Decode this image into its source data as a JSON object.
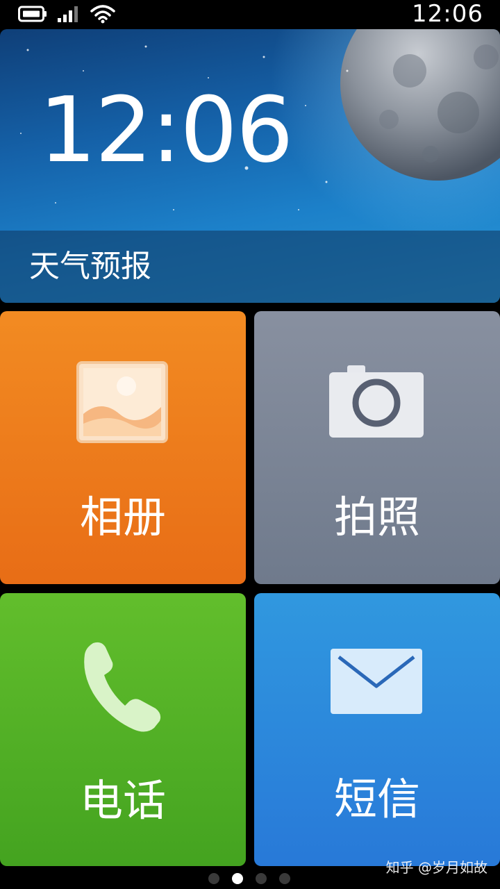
{
  "status_bar": {
    "time": "12:06",
    "icons": [
      "battery-icon",
      "signal-icon",
      "wifi-icon"
    ]
  },
  "banner": {
    "clock": "12:06",
    "weather_label": "天气预报"
  },
  "tiles": [
    {
      "label": "相册",
      "icon": "gallery-icon",
      "color": "#f0801c"
    },
    {
      "label": "拍照",
      "icon": "camera-icon",
      "color": "#7c8597"
    },
    {
      "label": "电话",
      "icon": "phone-icon",
      "color": "#52b126"
    },
    {
      "label": "短信",
      "icon": "mail-icon",
      "color": "#2c88dc"
    }
  ],
  "page_indicator": {
    "count": 4,
    "active": 2
  },
  "watermark": "知乎 @岁月如故"
}
